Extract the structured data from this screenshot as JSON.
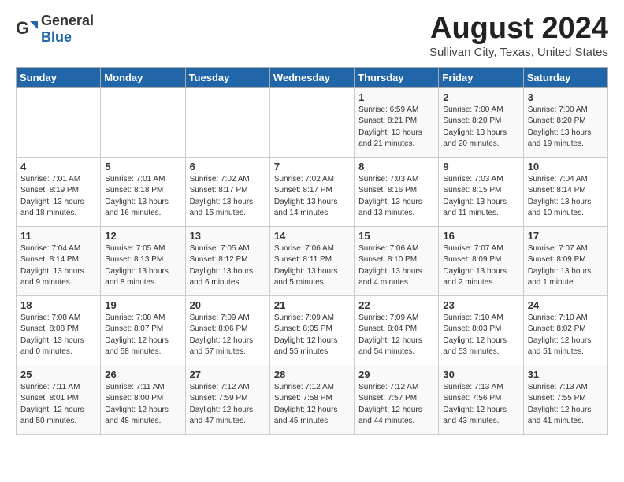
{
  "logo": {
    "general": "General",
    "blue": "Blue"
  },
  "header": {
    "month": "August 2024",
    "location": "Sullivan City, Texas, United States"
  },
  "weekdays": [
    "Sunday",
    "Monday",
    "Tuesday",
    "Wednesday",
    "Thursday",
    "Friday",
    "Saturday"
  ],
  "weeks": [
    [
      {
        "day": "",
        "info": ""
      },
      {
        "day": "",
        "info": ""
      },
      {
        "day": "",
        "info": ""
      },
      {
        "day": "",
        "info": ""
      },
      {
        "day": "1",
        "info": "Sunrise: 6:59 AM\nSunset: 8:21 PM\nDaylight: 13 hours\nand 21 minutes."
      },
      {
        "day": "2",
        "info": "Sunrise: 7:00 AM\nSunset: 8:20 PM\nDaylight: 13 hours\nand 20 minutes."
      },
      {
        "day": "3",
        "info": "Sunrise: 7:00 AM\nSunset: 8:20 PM\nDaylight: 13 hours\nand 19 minutes."
      }
    ],
    [
      {
        "day": "4",
        "info": "Sunrise: 7:01 AM\nSunset: 8:19 PM\nDaylight: 13 hours\nand 18 minutes."
      },
      {
        "day": "5",
        "info": "Sunrise: 7:01 AM\nSunset: 8:18 PM\nDaylight: 13 hours\nand 16 minutes."
      },
      {
        "day": "6",
        "info": "Sunrise: 7:02 AM\nSunset: 8:17 PM\nDaylight: 13 hours\nand 15 minutes."
      },
      {
        "day": "7",
        "info": "Sunrise: 7:02 AM\nSunset: 8:17 PM\nDaylight: 13 hours\nand 14 minutes."
      },
      {
        "day": "8",
        "info": "Sunrise: 7:03 AM\nSunset: 8:16 PM\nDaylight: 13 hours\nand 13 minutes."
      },
      {
        "day": "9",
        "info": "Sunrise: 7:03 AM\nSunset: 8:15 PM\nDaylight: 13 hours\nand 11 minutes."
      },
      {
        "day": "10",
        "info": "Sunrise: 7:04 AM\nSunset: 8:14 PM\nDaylight: 13 hours\nand 10 minutes."
      }
    ],
    [
      {
        "day": "11",
        "info": "Sunrise: 7:04 AM\nSunset: 8:14 PM\nDaylight: 13 hours\nand 9 minutes."
      },
      {
        "day": "12",
        "info": "Sunrise: 7:05 AM\nSunset: 8:13 PM\nDaylight: 13 hours\nand 8 minutes."
      },
      {
        "day": "13",
        "info": "Sunrise: 7:05 AM\nSunset: 8:12 PM\nDaylight: 13 hours\nand 6 minutes."
      },
      {
        "day": "14",
        "info": "Sunrise: 7:06 AM\nSunset: 8:11 PM\nDaylight: 13 hours\nand 5 minutes."
      },
      {
        "day": "15",
        "info": "Sunrise: 7:06 AM\nSunset: 8:10 PM\nDaylight: 13 hours\nand 4 minutes."
      },
      {
        "day": "16",
        "info": "Sunrise: 7:07 AM\nSunset: 8:09 PM\nDaylight: 13 hours\nand 2 minutes."
      },
      {
        "day": "17",
        "info": "Sunrise: 7:07 AM\nSunset: 8:09 PM\nDaylight: 13 hours\nand 1 minute."
      }
    ],
    [
      {
        "day": "18",
        "info": "Sunrise: 7:08 AM\nSunset: 8:08 PM\nDaylight: 13 hours\nand 0 minutes."
      },
      {
        "day": "19",
        "info": "Sunrise: 7:08 AM\nSunset: 8:07 PM\nDaylight: 12 hours\nand 58 minutes."
      },
      {
        "day": "20",
        "info": "Sunrise: 7:09 AM\nSunset: 8:06 PM\nDaylight: 12 hours\nand 57 minutes."
      },
      {
        "day": "21",
        "info": "Sunrise: 7:09 AM\nSunset: 8:05 PM\nDaylight: 12 hours\nand 55 minutes."
      },
      {
        "day": "22",
        "info": "Sunrise: 7:09 AM\nSunset: 8:04 PM\nDaylight: 12 hours\nand 54 minutes."
      },
      {
        "day": "23",
        "info": "Sunrise: 7:10 AM\nSunset: 8:03 PM\nDaylight: 12 hours\nand 53 minutes."
      },
      {
        "day": "24",
        "info": "Sunrise: 7:10 AM\nSunset: 8:02 PM\nDaylight: 12 hours\nand 51 minutes."
      }
    ],
    [
      {
        "day": "25",
        "info": "Sunrise: 7:11 AM\nSunset: 8:01 PM\nDaylight: 12 hours\nand 50 minutes."
      },
      {
        "day": "26",
        "info": "Sunrise: 7:11 AM\nSunset: 8:00 PM\nDaylight: 12 hours\nand 48 minutes."
      },
      {
        "day": "27",
        "info": "Sunrise: 7:12 AM\nSunset: 7:59 PM\nDaylight: 12 hours\nand 47 minutes."
      },
      {
        "day": "28",
        "info": "Sunrise: 7:12 AM\nSunset: 7:58 PM\nDaylight: 12 hours\nand 45 minutes."
      },
      {
        "day": "29",
        "info": "Sunrise: 7:12 AM\nSunset: 7:57 PM\nDaylight: 12 hours\nand 44 minutes."
      },
      {
        "day": "30",
        "info": "Sunrise: 7:13 AM\nSunset: 7:56 PM\nDaylight: 12 hours\nand 43 minutes."
      },
      {
        "day": "31",
        "info": "Sunrise: 7:13 AM\nSunset: 7:55 PM\nDaylight: 12 hours\nand 41 minutes."
      }
    ]
  ]
}
